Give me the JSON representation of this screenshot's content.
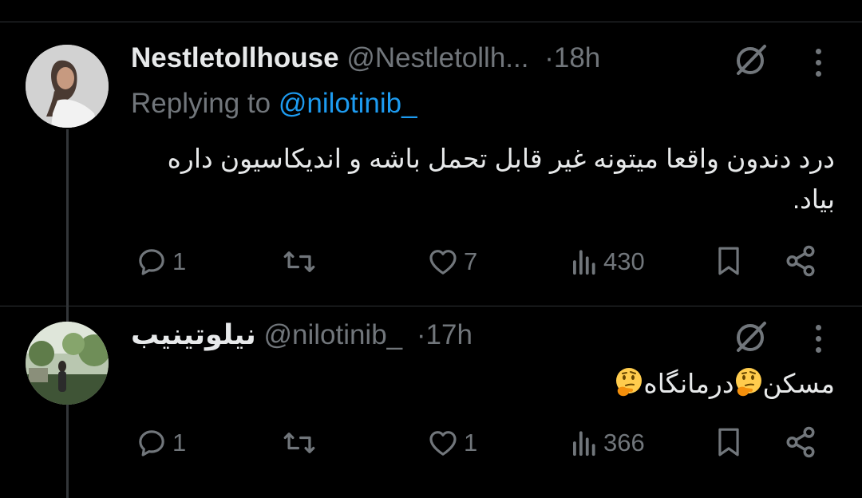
{
  "tweets": [
    {
      "display_name": "Nestletollhouse",
      "handle": "@Nestletollh...",
      "separator": "·",
      "time": "18h",
      "replying_to_label": "Replying to",
      "replying_to_handle": "@nilotinib_",
      "text": "درد دندون واقعا میتونه غیر قابل تحمل باشه و اندیکاسیون داره بیاد.",
      "replies": "1",
      "likes": "7",
      "views": "430"
    },
    {
      "display_name": "نیلوتینیب",
      "handle": "@nilotinib_",
      "separator": "·",
      "time": "17h",
      "text_part1": "مسکن",
      "text_part2": "درمانگاه",
      "emoji": "thinking-face",
      "replies": "1",
      "likes": "1",
      "views": "366"
    }
  ],
  "icons": {
    "reply": "reply-icon",
    "retweet": "retweet-icon",
    "like": "heart-icon",
    "views": "views-icon",
    "bookmark": "bookmark-icon",
    "share": "share-icon",
    "grok": "grok-icon",
    "more": "more-icon"
  },
  "colors": {
    "background": "#000000",
    "text": "#e7e9ea",
    "muted": "#71767b",
    "link": "#1d9bf0",
    "emoji": "#ffcc4d"
  }
}
